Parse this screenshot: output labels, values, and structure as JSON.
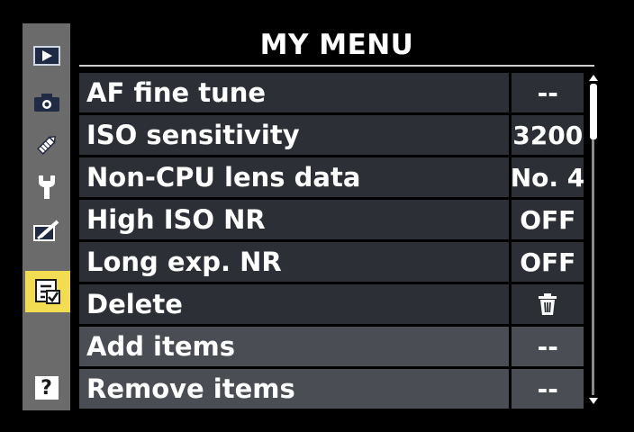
{
  "title": "MY MENU",
  "sidebar": {
    "items": [
      {
        "icon": "playback-icon",
        "active": false
      },
      {
        "icon": "camera-icon",
        "active": false
      },
      {
        "icon": "pencil-icon",
        "active": false
      },
      {
        "icon": "wrench-icon",
        "active": false
      },
      {
        "icon": "retouch-brush-icon",
        "active": false
      },
      {
        "icon": "my-menu-icon",
        "active": true
      },
      {
        "icon": "help-icon",
        "label": "?",
        "active": false
      }
    ]
  },
  "menu": {
    "items": [
      {
        "label": "AF fine tune",
        "value": "--"
      },
      {
        "label": "ISO sensitivity",
        "value": "3200"
      },
      {
        "label": "Non-CPU lens data",
        "value": "No. 4"
      },
      {
        "label": "High ISO NR",
        "value": "OFF"
      },
      {
        "label": "Long exp. NR",
        "value": "OFF"
      },
      {
        "label": "Delete",
        "value_icon": "trash-icon"
      },
      {
        "label": "Add items",
        "value": "--"
      },
      {
        "label": "Remove items",
        "value": "--"
      }
    ]
  },
  "colors": {
    "background": "#000000",
    "sidebar": "#6b6b6b",
    "active_tab": "#f1dc52",
    "row_dark": "#2c2f36",
    "row_light": "#4a4d54",
    "text": "#ffffff"
  }
}
